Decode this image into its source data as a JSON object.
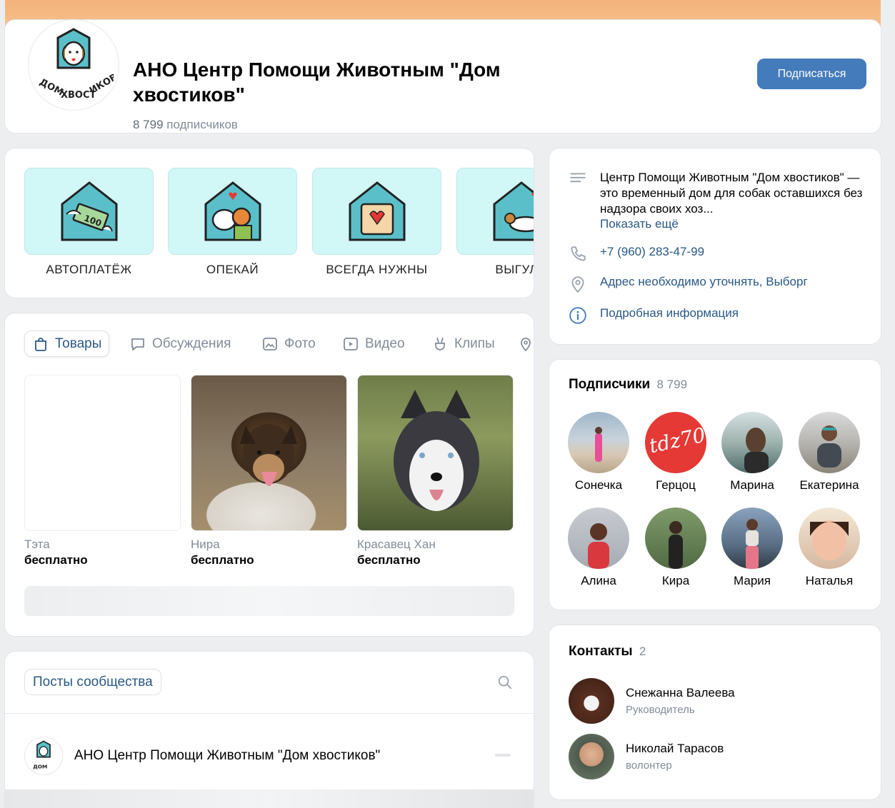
{
  "header": {
    "title": "АНО Центр Помощи Животным \"Дом хвостиков\"",
    "subscribers_value": "8 799",
    "subscribers_label": "подписчиков",
    "subscribe_label": "Подписаться",
    "cover_color": "#f4b37b",
    "accent": "#447bba"
  },
  "widgets": {
    "tiles": [
      {
        "label": "АВТОПЛАТЁЖ",
        "icon": "money-house-icon"
      },
      {
        "label": "ОПЕКАЙ",
        "icon": "hug-house-icon"
      },
      {
        "label": "ВСЕГДА НУЖНЫ",
        "icon": "heart-bag-house-icon"
      },
      {
        "label": "ВЫГУЛИ",
        "icon": "dog-walk-house-icon"
      }
    ]
  },
  "tabs": [
    {
      "label": "Товары",
      "icon": "bag-icon",
      "active": true
    },
    {
      "label": "Обсуждения",
      "icon": "chat-icon"
    },
    {
      "label": "Фото",
      "icon": "photo-icon"
    },
    {
      "label": "Видео",
      "icon": "video-icon"
    },
    {
      "label": "Клипы",
      "icon": "clips-icon"
    }
  ],
  "products": [
    {
      "name": "Тэта",
      "price": "бесплатно"
    },
    {
      "name": "Нира",
      "price": "бесплатно"
    },
    {
      "name": "Красавец Хан",
      "price": "бесплатно"
    }
  ],
  "posts": {
    "tab_label": "Посты сообщества",
    "author": "АНО Центр Помощи Животным \"Дом хвостиков\""
  },
  "info": {
    "description": "Центр Помощи Животным \"Дом хвостиков\" — это временный дом для собак оставшихся без надзора своих хоз...",
    "show_more": "Показать ещё",
    "phone": "+7 (960) 283-47-99",
    "address": "Адрес необходимо уточнять, Выборг",
    "details": "Подробная информация"
  },
  "subscribers": {
    "title": "Подписчики",
    "count": "8 799",
    "members": [
      "Сонечка",
      "Герцоц",
      "Марина",
      "Екатерина",
      "Алина",
      "Кира",
      "Мария",
      "Наталья"
    ]
  },
  "contacts": {
    "title": "Контакты",
    "count": "2",
    "people": [
      {
        "name": "Снежанна Валеева",
        "role": "Руководитель"
      },
      {
        "name": "Николай Тарасов",
        "role": "волонтер"
      }
    ]
  }
}
